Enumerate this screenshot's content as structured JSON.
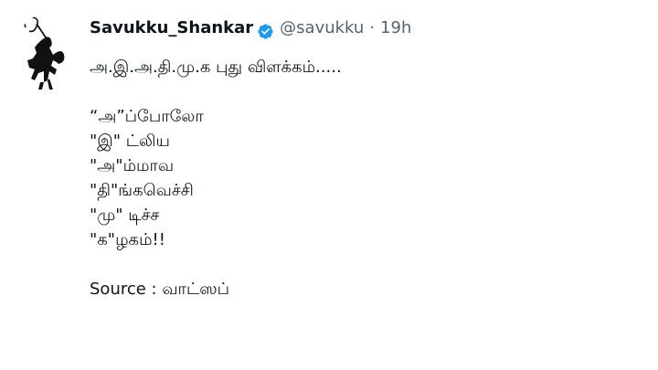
{
  "user": {
    "display_name": "Savukku_Shankar",
    "handle": "@savukku",
    "separator": "·",
    "timestamp": "19h",
    "verified_icon": "verified-badge-icon",
    "accent_color": "#1d9bf0"
  },
  "tweet": {
    "lines": [
      "அ.இ.அ.தி.மு.க புது விளக்கம்.....",
      "",
      "“அ”ப்போலோ",
      "\"இ\" ட்லிய",
      "\"அ\"ம்மாவ",
      "\"தி\"ங்கவெச்சி",
      "\"மு\" டிச்ச",
      "\"க\"ழகம்!!",
      "",
      "Source : வாட்ஸப்"
    ]
  }
}
